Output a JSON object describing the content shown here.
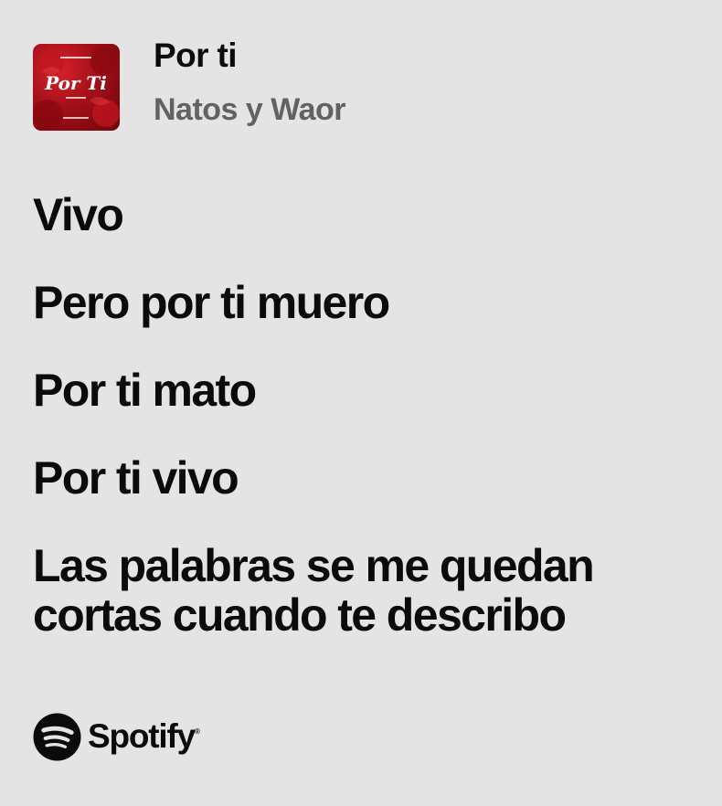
{
  "song": {
    "title": "Por ti",
    "artist": "Natos y Waor"
  },
  "cover_art": {
    "title_text": "Por Ti",
    "accent_color": "#b3111b"
  },
  "lyrics": {
    "lines": [
      "Vivo",
      "Pero por ti muero",
      "Por ti mato",
      "Por ti vivo",
      "Las palabras se me quedan cortas cuando te describo"
    ]
  },
  "branding": {
    "name": "Spotify",
    "registered_mark": "®",
    "icon": "spotify-icon"
  },
  "colors": {
    "background": "#e4e4e4",
    "text": "#0b0b0b",
    "artist_text": "#626262"
  }
}
